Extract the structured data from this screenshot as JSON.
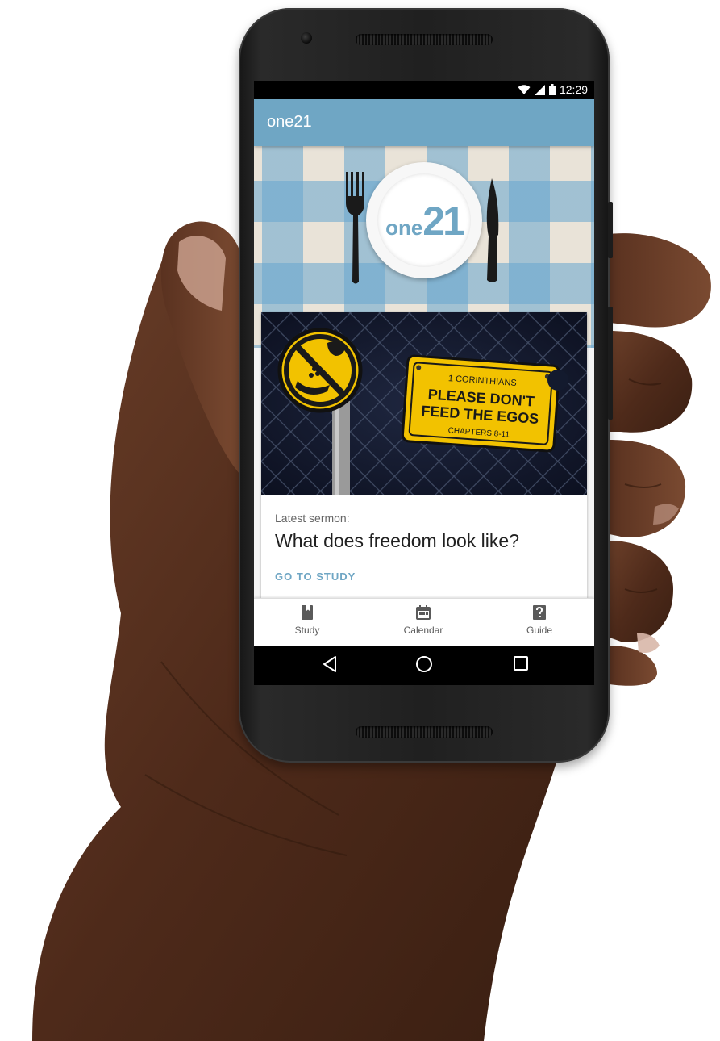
{
  "status_bar": {
    "time": "12:29",
    "icons": [
      "wifi-icon",
      "signal-icon",
      "battery-icon"
    ]
  },
  "app_bar": {
    "title": "one21"
  },
  "hero": {
    "logo_text_small": "one",
    "logo_text_large": "21"
  },
  "sermon_art": {
    "sign_line1": "1 CORINTHIANS",
    "sign_line2": "PLEASE DON'T",
    "sign_line3": "FEED THE EGOS",
    "sign_line4": "CHAPTERS 8-11"
  },
  "card": {
    "caption": "Latest sermon:",
    "title": "What does freedom look like?",
    "action": "GO TO STUDY"
  },
  "bottom_nav": {
    "items": [
      {
        "label": "Study",
        "icon": "book-icon"
      },
      {
        "label": "Calendar",
        "icon": "calendar-icon"
      },
      {
        "label": "Guide",
        "icon": "help-icon"
      }
    ]
  },
  "system_nav": {
    "icons": [
      "back-icon",
      "home-icon",
      "recents-icon"
    ]
  },
  "colors": {
    "accent": "#6fa6c4",
    "gingham": "#66a6cf",
    "sign_yellow": "#f2c200"
  }
}
